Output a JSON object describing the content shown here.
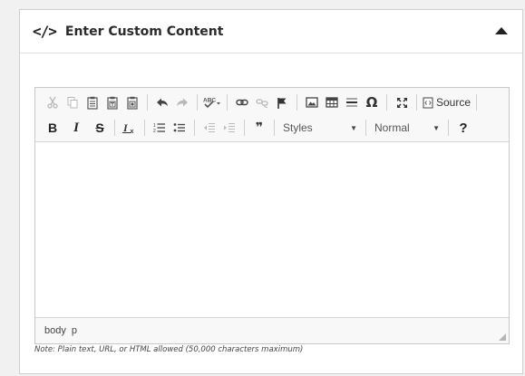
{
  "panel": {
    "title": "Enter Custom Content",
    "header_icon": "code-icon",
    "header_icon_glyph": "</>",
    "collapse_icon": "collapse-up-icon"
  },
  "toolbar": {
    "row1": {
      "cut_icon": "cut-icon",
      "copy_icon": "copy-icon",
      "paste_icon": "paste-icon",
      "paste_text_icon": "paste-text-icon",
      "paste_word_icon": "paste-word-icon",
      "undo_icon": "undo-icon",
      "redo_icon": "redo-icon",
      "spellcheck_icon": "spellcheck-icon",
      "link_icon": "link-icon",
      "unlink_icon": "unlink-icon",
      "anchor_icon": "anchor-flag-icon",
      "image_icon": "image-icon",
      "table_icon": "table-icon",
      "hr_icon": "horizontal-line-icon",
      "special_char_glyph": "Ω",
      "maximize_icon": "maximize-icon",
      "source_label": "Source"
    },
    "row2": {
      "bold": "B",
      "italic": "I",
      "strike": "S",
      "remove_format": "Ix",
      "numbered_list_icon": "numbered-list-icon",
      "bulleted_list_icon": "bulleted-list-icon",
      "outdent_icon": "outdent-icon",
      "indent_icon": "indent-icon",
      "blockquote_glyph": "❞",
      "styles_label": "Styles",
      "format_label": "Normal",
      "help_glyph": "?"
    }
  },
  "status_bar": {
    "path": [
      "body",
      "p"
    ]
  },
  "note": "Note: Plain text, URL, or HTML allowed (50,000 characters maximum)",
  "colors": {
    "background": "#f1f1f1",
    "panel_border": "#cfcfcf",
    "toolbar_bg": "#f8f8f8",
    "icon_color": "#474747",
    "disabled_icon": "#b8b8b8"
  }
}
